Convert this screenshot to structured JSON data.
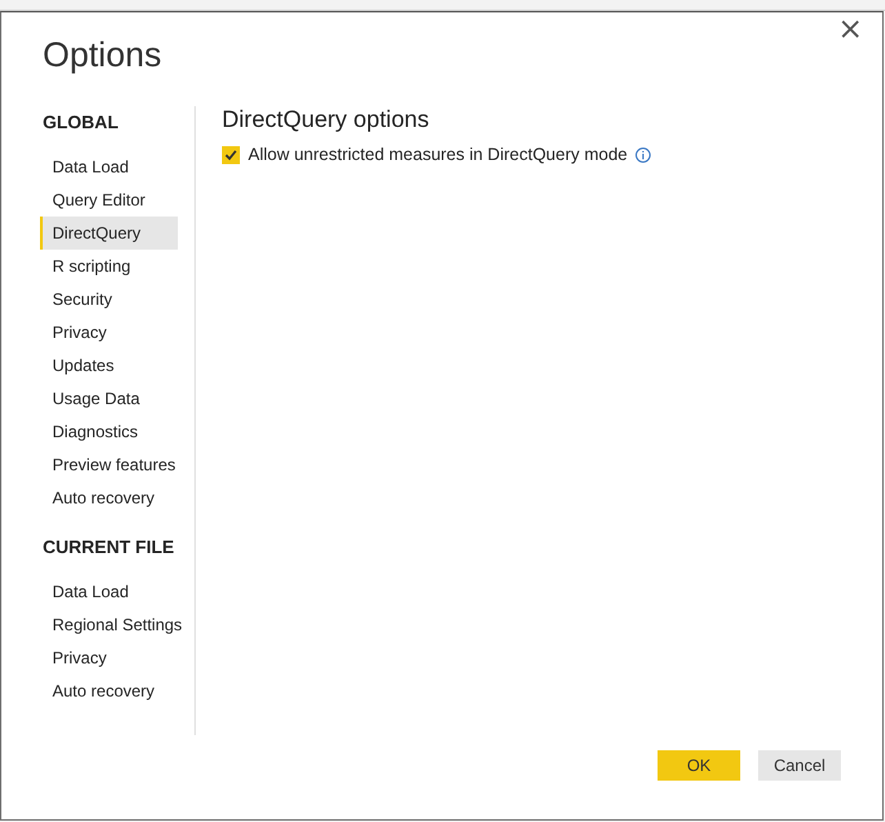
{
  "dialog": {
    "title": "Options",
    "close": "×"
  },
  "sidebar": {
    "sections": [
      {
        "heading": "GLOBAL",
        "items": [
          {
            "label": "Data Load",
            "selected": false
          },
          {
            "label": "Query Editor",
            "selected": false
          },
          {
            "label": "DirectQuery",
            "selected": true
          },
          {
            "label": "R scripting",
            "selected": false
          },
          {
            "label": "Security",
            "selected": false
          },
          {
            "label": "Privacy",
            "selected": false
          },
          {
            "label": "Updates",
            "selected": false
          },
          {
            "label": "Usage Data",
            "selected": false
          },
          {
            "label": "Diagnostics",
            "selected": false
          },
          {
            "label": "Preview features",
            "selected": false
          },
          {
            "label": "Auto recovery",
            "selected": false
          }
        ]
      },
      {
        "heading": "CURRENT FILE",
        "items": [
          {
            "label": "Data Load",
            "selected": false
          },
          {
            "label": "Regional Settings",
            "selected": false
          },
          {
            "label": "Privacy",
            "selected": false
          },
          {
            "label": "Auto recovery",
            "selected": false
          }
        ]
      }
    ]
  },
  "content": {
    "heading": "DirectQuery options",
    "options": [
      {
        "label": "Allow unrestricted measures in DirectQuery mode",
        "checked": true,
        "info": true
      }
    ]
  },
  "buttons": [
    {
      "label": "OK",
      "kind": "primary"
    },
    {
      "label": "Cancel",
      "kind": "secondary"
    }
  ]
}
